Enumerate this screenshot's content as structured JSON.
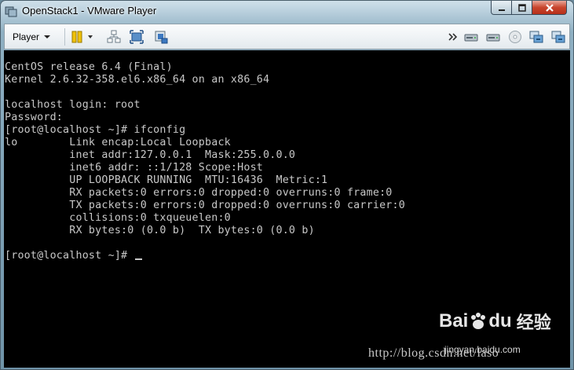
{
  "window": {
    "title": "OpenStack1 - VMware Player"
  },
  "toolbar": {
    "player_menu_label": "Player"
  },
  "terminal": {
    "lines": [
      "",
      "CentOS release 6.4 (Final)",
      "Kernel 2.6.32-358.el6.x86_64 on an x86_64",
      "",
      "localhost login: root",
      "Password:",
      "[root@localhost ~]# ifconfig",
      "lo        Link encap:Local Loopback",
      "          inet addr:127.0.0.1  Mask:255.0.0.0",
      "          inet6 addr: ::1/128 Scope:Host",
      "          UP LOOPBACK RUNNING  MTU:16436  Metric:1",
      "          RX packets:0 errors:0 dropped:0 overruns:0 frame:0",
      "          TX packets:0 errors:0 dropped:0 overruns:0 carrier:0",
      "          collisions:0 txqueuelen:0",
      "          RX bytes:0 (0.0 b)  TX bytes:0 (0.0 b)",
      "",
      "[root@localhost ~]# "
    ]
  },
  "watermark": {
    "logo_text_1": "Bai",
    "logo_text_2": "du",
    "logo_text_3": "经验",
    "site": "jingyan.baidu.com",
    "url": "http://blog.csdn.net/laso"
  },
  "icons": {
    "window_icon": "vmware-icon",
    "pause": "pause-icon",
    "network": "network-icon",
    "fullscreen": "fullscreen-icon",
    "unity": "unity-icon",
    "overflow": "chevron-right-icon",
    "device_1": "hard-disk-icon",
    "device_2": "hard-disk-icon",
    "device_3": "cd-icon",
    "device_4": "network-adapter-icon",
    "device_5": "network-adapter-icon"
  },
  "colors": {
    "terminal_bg": "#000000",
    "terminal_fg": "#c8c8c8",
    "pause_accent": "#e8b800"
  }
}
